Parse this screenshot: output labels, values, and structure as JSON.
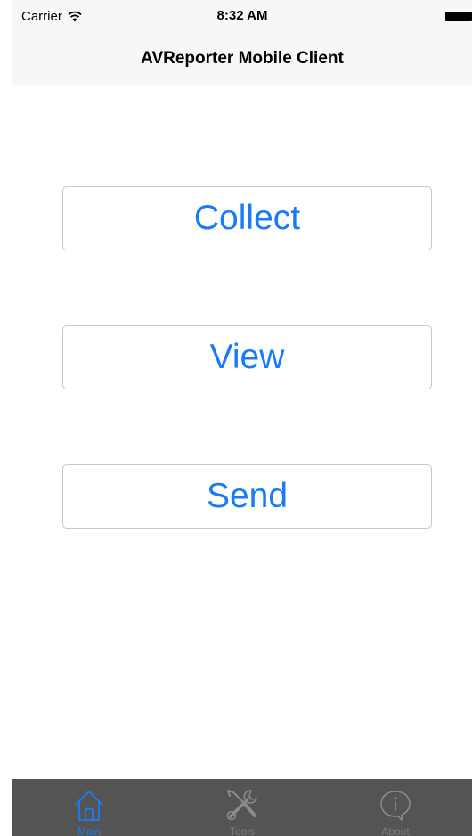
{
  "status_bar": {
    "carrier": "Carrier",
    "time": "8:32 AM"
  },
  "nav": {
    "title": "AVReporter Mobile Client"
  },
  "buttons": {
    "collect": "Collect",
    "view": "View",
    "send": "Send"
  },
  "tabs": [
    {
      "label": "Main",
      "icon": "home-icon",
      "active": true
    },
    {
      "label": "Tools",
      "icon": "tools-icon",
      "active": false
    },
    {
      "label": "About",
      "icon": "info-icon",
      "active": false
    }
  ],
  "colors": {
    "accent": "#1a7cf5",
    "tab_bar_background": "#545454",
    "tab_inactive": "#7a7a7a"
  }
}
